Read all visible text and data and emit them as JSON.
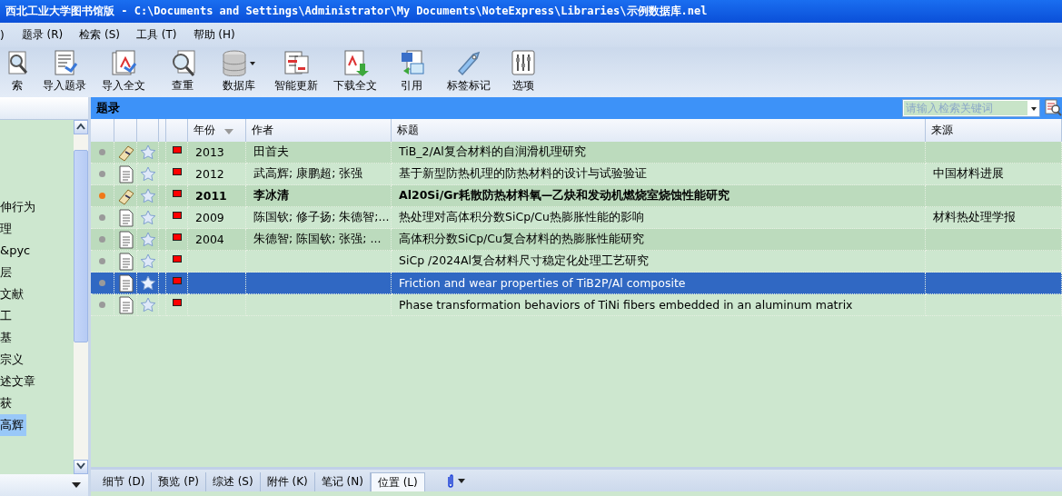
{
  "window": {
    "title": "西北工业大学图书馆版 - C:\\Documents and Settings\\Administrator\\My Documents\\NoteExpress\\Libraries\\示例数据库.nel"
  },
  "menu": [
    ")",
    "题录 (R)",
    "检索 (S)",
    "工具 (T)",
    "帮助 (H)"
  ],
  "toolbar": [
    {
      "kind": "search",
      "label": "索"
    },
    {
      "kind": "import",
      "label": "导入题录"
    },
    {
      "kind": "fulltext",
      "label": "导入全文"
    },
    {
      "kind": "dup",
      "label": "查重"
    },
    {
      "kind": "database",
      "label": "数据库"
    },
    {
      "kind": "update",
      "label": "智能更新"
    },
    {
      "kind": "download",
      "label": "下载全文"
    },
    {
      "kind": "cite",
      "label": "引用"
    },
    {
      "kind": "tag",
      "label": "标签标记"
    },
    {
      "kind": "options",
      "label": "选项"
    }
  ],
  "sidebar": {
    "items": [
      {
        "label": "伸行为",
        "selected": false
      },
      {
        "label": "理",
        "selected": false
      },
      {
        "label": "&pyc",
        "selected": false
      },
      {
        "label": "层",
        "selected": false
      },
      {
        "label": "文献",
        "selected": false
      },
      {
        "label": "工",
        "selected": false
      },
      {
        "label": "基",
        "selected": false
      },
      {
        "label": "宗义",
        "selected": false
      },
      {
        "label": "述文章",
        "selected": false
      },
      {
        "label": "获",
        "selected": false
      },
      {
        "label": "高辉",
        "selected": true
      }
    ]
  },
  "panel": {
    "title": "题录",
    "search": {
      "placeholder": "请输入检索关键词"
    }
  },
  "table": {
    "columns": [
      "年份",
      "作者",
      "标题",
      "来源"
    ],
    "rows": [
      {
        "color": "#9a9a9a",
        "kind": "scroll",
        "unread": false,
        "selected": false,
        "year": "2013",
        "author": "田首夫",
        "title": "TiB_2/Al复合材料的自润滑机理研究"
      },
      {
        "color": "#9a9a9a",
        "kind": "document",
        "unread": false,
        "selected": false,
        "year": "2012",
        "author": "武高辉; 康鹏超; 张强",
        "title": "基于新型防热机理的防热材料的设计与试验验证",
        "source": "中国材料进展"
      },
      {
        "color": "#f07818",
        "kind": "scroll",
        "unread": true,
        "selected": false,
        "year": "2011",
        "author": "李冰清",
        "title": "Al20Si/Gr耗散防热材料氧—乙炔和发动机燃烧室烧蚀性能研究"
      },
      {
        "color": "#9a9a9a",
        "kind": "document",
        "unread": false,
        "selected": false,
        "year": "2009",
        "author": "陈国钦; 修子扬; 朱德智;...",
        "title": "热处理对高体积分数SiCp/Cu热膨胀性能的影响",
        "source": "材料热处理学报"
      },
      {
        "color": "#9a9a9a",
        "kind": "document",
        "unread": false,
        "selected": false,
        "year": "2004",
        "author": "朱德智; 陈国钦; 张强; ...",
        "title": "高体积分数SiCp/Cu复合材料的热膨胀性能研究"
      },
      {
        "color": "#9a9a9a",
        "kind": "document",
        "unread": false,
        "selected": false,
        "title": "SiCp /2024Al复合材料尺寸稳定化处理工艺研究"
      },
      {
        "color": "#9a9a9a",
        "kind": "document",
        "unread": false,
        "selected": true,
        "title": "Friction and wear properties of TiB2P/Al composite"
      },
      {
        "color": "#9a9a9a",
        "kind": "document",
        "unread": false,
        "selected": false,
        "title": "Phase transformation behaviors of TiNi fibers embedded in an aluminum matrix"
      }
    ]
  },
  "bottom_tabs": [
    {
      "label": "细节 (D)",
      "selected": false
    },
    {
      "label": "预览 (P)",
      "selected": false
    },
    {
      "label": "综述 (S)",
      "selected": false
    },
    {
      "label": "附件 (K)",
      "selected": false
    },
    {
      "label": "笔记 (N)",
      "selected": false
    },
    {
      "label": "位置 (L)",
      "selected": true
    }
  ]
}
